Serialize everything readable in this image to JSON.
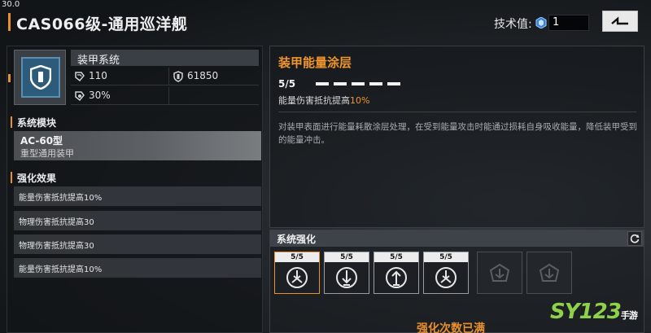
{
  "overlay": {
    "fps": "30.0"
  },
  "header": {
    "title": "CAS066级-通用巡洋舰",
    "tech_label": "技术值:",
    "tech_value": "1"
  },
  "system": {
    "name": "装甲系统",
    "stats": [
      {
        "icon": "armor-stat-icon",
        "value": "110"
      },
      {
        "icon": "shield-stat-icon",
        "value": "61850"
      },
      {
        "icon": "resist-stat-icon",
        "value": "30%"
      }
    ]
  },
  "module": {
    "section_title": "系统模块",
    "name": "AC-60型",
    "subtitle": "重型通用装甲"
  },
  "effects": {
    "section_title": "强化效果",
    "items": [
      "能量伤害抵抗提高10%",
      "物理伤害抵抗提高30",
      "物理伤害抵抗提高30",
      "能量伤害抵抗提高10%"
    ]
  },
  "detail": {
    "title": "装甲能量涂层",
    "level": "5/5",
    "level_value": 5,
    "level_max": 5,
    "effect_prefix": "能量伤害抵抗提高",
    "effect_value": "10%",
    "description": "对装甲表面进行能量耗散涂层处理，在受到能量攻击时能通过损耗自身吸收能量，降低装甲受到的能量冲击。"
  },
  "enhance": {
    "title": "系统强化",
    "slots": [
      {
        "level": "5/5",
        "icon": "energy-burst-icon",
        "state": "active"
      },
      {
        "level": "5/5",
        "icon": "arrow-down-icon",
        "state": "unlocked"
      },
      {
        "level": "5/5",
        "icon": "arrow-up-icon",
        "state": "unlocked"
      },
      {
        "level": "5/5",
        "icon": "energy-burst-icon",
        "state": "unlocked"
      },
      {
        "level": "",
        "icon": "locked-emblem-icon",
        "state": "locked"
      },
      {
        "level": "",
        "icon": "locked-emblem-icon",
        "state": "locked"
      }
    ],
    "maxed_text": "强化次数已满"
  },
  "watermark": {
    "text": "SY123",
    "small": "手游"
  },
  "colors": {
    "accent": "#e8902d",
    "panel": "#3e4349",
    "icon_blue": "#2c5b7c"
  }
}
